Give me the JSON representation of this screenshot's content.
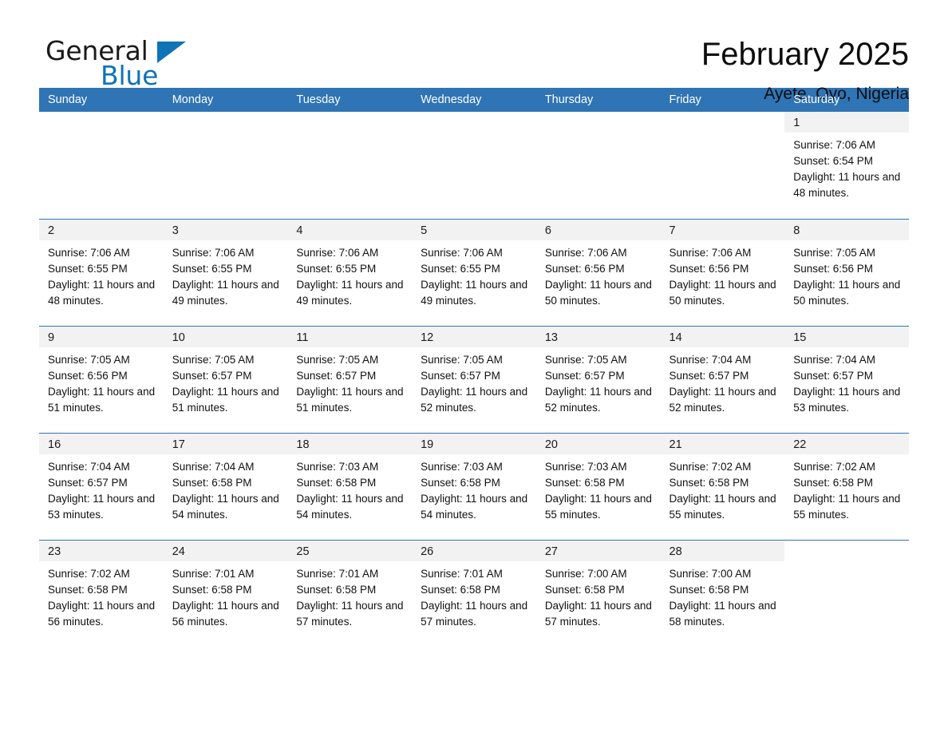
{
  "logo": {
    "word_one": "General",
    "word_two": "Blue",
    "flag_icon": "triangle-flag-icon",
    "brand_color": "#1073b8"
  },
  "header": {
    "title": "February 2025",
    "location": "Ayete, Oyo, Nigeria"
  },
  "calendar": {
    "header_bg": "#2f74b5",
    "daynum_bg": "#f2f2f2",
    "weekday_headers": [
      "Sunday",
      "Monday",
      "Tuesday",
      "Wednesday",
      "Thursday",
      "Friday",
      "Saturday"
    ],
    "weeks": [
      [
        {
          "day": "",
          "blank": true
        },
        {
          "day": "",
          "blank": true
        },
        {
          "day": "",
          "blank": true
        },
        {
          "day": "",
          "blank": true
        },
        {
          "day": "",
          "blank": true
        },
        {
          "day": "",
          "blank": true
        },
        {
          "day": "1",
          "sunrise": "Sunrise: 7:06 AM",
          "sunset": "Sunset: 6:54 PM",
          "daylight": "Daylight: 11 hours and 48 minutes."
        }
      ],
      [
        {
          "day": "2",
          "sunrise": "Sunrise: 7:06 AM",
          "sunset": "Sunset: 6:55 PM",
          "daylight": "Daylight: 11 hours and 48 minutes."
        },
        {
          "day": "3",
          "sunrise": "Sunrise: 7:06 AM",
          "sunset": "Sunset: 6:55 PM",
          "daylight": "Daylight: 11 hours and 49 minutes."
        },
        {
          "day": "4",
          "sunrise": "Sunrise: 7:06 AM",
          "sunset": "Sunset: 6:55 PM",
          "daylight": "Daylight: 11 hours and 49 minutes."
        },
        {
          "day": "5",
          "sunrise": "Sunrise: 7:06 AM",
          "sunset": "Sunset: 6:55 PM",
          "daylight": "Daylight: 11 hours and 49 minutes."
        },
        {
          "day": "6",
          "sunrise": "Sunrise: 7:06 AM",
          "sunset": "Sunset: 6:56 PM",
          "daylight": "Daylight: 11 hours and 50 minutes."
        },
        {
          "day": "7",
          "sunrise": "Sunrise: 7:06 AM",
          "sunset": "Sunset: 6:56 PM",
          "daylight": "Daylight: 11 hours and 50 minutes."
        },
        {
          "day": "8",
          "sunrise": "Sunrise: 7:05 AM",
          "sunset": "Sunset: 6:56 PM",
          "daylight": "Daylight: 11 hours and 50 minutes."
        }
      ],
      [
        {
          "day": "9",
          "sunrise": "Sunrise: 7:05 AM",
          "sunset": "Sunset: 6:56 PM",
          "daylight": "Daylight: 11 hours and 51 minutes."
        },
        {
          "day": "10",
          "sunrise": "Sunrise: 7:05 AM",
          "sunset": "Sunset: 6:57 PM",
          "daylight": "Daylight: 11 hours and 51 minutes."
        },
        {
          "day": "11",
          "sunrise": "Sunrise: 7:05 AM",
          "sunset": "Sunset: 6:57 PM",
          "daylight": "Daylight: 11 hours and 51 minutes."
        },
        {
          "day": "12",
          "sunrise": "Sunrise: 7:05 AM",
          "sunset": "Sunset: 6:57 PM",
          "daylight": "Daylight: 11 hours and 52 minutes."
        },
        {
          "day": "13",
          "sunrise": "Sunrise: 7:05 AM",
          "sunset": "Sunset: 6:57 PM",
          "daylight": "Daylight: 11 hours and 52 minutes."
        },
        {
          "day": "14",
          "sunrise": "Sunrise: 7:04 AM",
          "sunset": "Sunset: 6:57 PM",
          "daylight": "Daylight: 11 hours and 52 minutes."
        },
        {
          "day": "15",
          "sunrise": "Sunrise: 7:04 AM",
          "sunset": "Sunset: 6:57 PM",
          "daylight": "Daylight: 11 hours and 53 minutes."
        }
      ],
      [
        {
          "day": "16",
          "sunrise": "Sunrise: 7:04 AM",
          "sunset": "Sunset: 6:57 PM",
          "daylight": "Daylight: 11 hours and 53 minutes."
        },
        {
          "day": "17",
          "sunrise": "Sunrise: 7:04 AM",
          "sunset": "Sunset: 6:58 PM",
          "daylight": "Daylight: 11 hours and 54 minutes."
        },
        {
          "day": "18",
          "sunrise": "Sunrise: 7:03 AM",
          "sunset": "Sunset: 6:58 PM",
          "daylight": "Daylight: 11 hours and 54 minutes."
        },
        {
          "day": "19",
          "sunrise": "Sunrise: 7:03 AM",
          "sunset": "Sunset: 6:58 PM",
          "daylight": "Daylight: 11 hours and 54 minutes."
        },
        {
          "day": "20",
          "sunrise": "Sunrise: 7:03 AM",
          "sunset": "Sunset: 6:58 PM",
          "daylight": "Daylight: 11 hours and 55 minutes."
        },
        {
          "day": "21",
          "sunrise": "Sunrise: 7:02 AM",
          "sunset": "Sunset: 6:58 PM",
          "daylight": "Daylight: 11 hours and 55 minutes."
        },
        {
          "day": "22",
          "sunrise": "Sunrise: 7:02 AM",
          "sunset": "Sunset: 6:58 PM",
          "daylight": "Daylight: 11 hours and 55 minutes."
        }
      ],
      [
        {
          "day": "23",
          "sunrise": "Sunrise: 7:02 AM",
          "sunset": "Sunset: 6:58 PM",
          "daylight": "Daylight: 11 hours and 56 minutes."
        },
        {
          "day": "24",
          "sunrise": "Sunrise: 7:01 AM",
          "sunset": "Sunset: 6:58 PM",
          "daylight": "Daylight: 11 hours and 56 minutes."
        },
        {
          "day": "25",
          "sunrise": "Sunrise: 7:01 AM",
          "sunset": "Sunset: 6:58 PM",
          "daylight": "Daylight: 11 hours and 57 minutes."
        },
        {
          "day": "26",
          "sunrise": "Sunrise: 7:01 AM",
          "sunset": "Sunset: 6:58 PM",
          "daylight": "Daylight: 11 hours and 57 minutes."
        },
        {
          "day": "27",
          "sunrise": "Sunrise: 7:00 AM",
          "sunset": "Sunset: 6:58 PM",
          "daylight": "Daylight: 11 hours and 57 minutes."
        },
        {
          "day": "28",
          "sunrise": "Sunrise: 7:00 AM",
          "sunset": "Sunset: 6:58 PM",
          "daylight": "Daylight: 11 hours and 58 minutes."
        },
        {
          "day": "",
          "blank": true
        }
      ]
    ]
  }
}
